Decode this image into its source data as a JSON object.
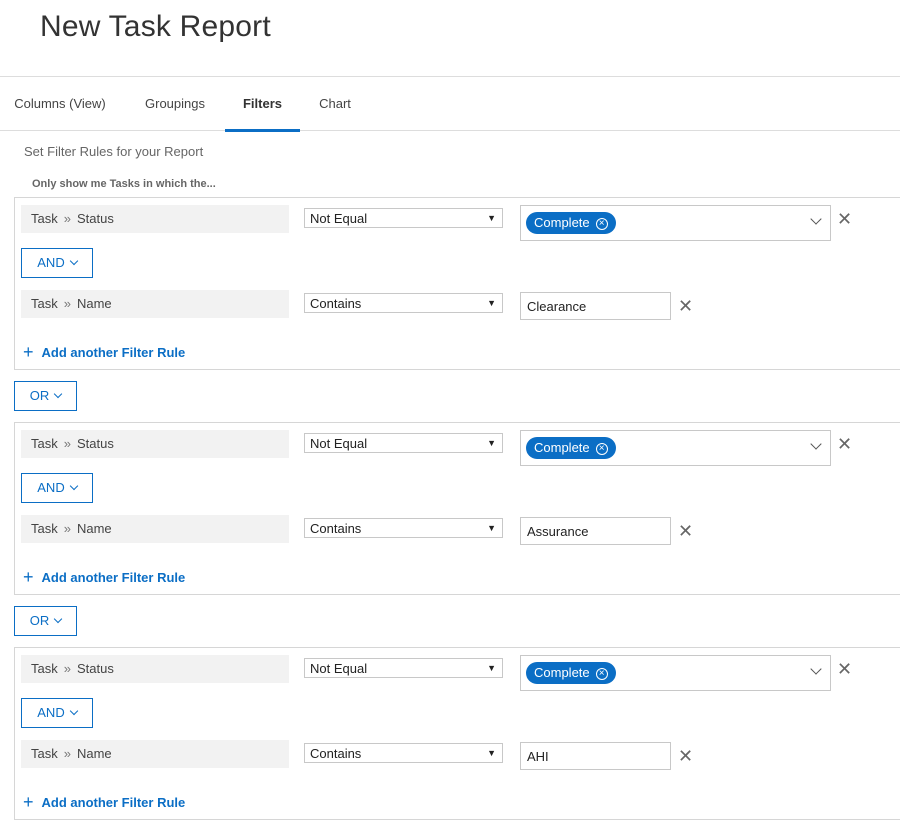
{
  "page": {
    "title": "New Task Report"
  },
  "tabs": [
    {
      "label": "Columns (View)"
    },
    {
      "label": "Groupings"
    },
    {
      "label": "Filters"
    },
    {
      "label": "Chart"
    }
  ],
  "filters": {
    "subtitle": "Set Filter Rules for your Report",
    "hint": "Only show me Tasks in which the...",
    "connector_label": "OR",
    "groups": [
      {
        "rule1": {
          "object": "Task",
          "field": "Status",
          "operator": "Not Equal",
          "value": "Complete"
        },
        "and_label": "AND",
        "rule2": {
          "object": "Task",
          "field": "Name",
          "operator": "Contains",
          "value": "Clearance"
        },
        "add_label": "Add another Filter Rule"
      },
      {
        "rule1": {
          "object": "Task",
          "field": "Status",
          "operator": "Not Equal",
          "value": "Complete"
        },
        "and_label": "AND",
        "rule2": {
          "object": "Task",
          "field": "Name",
          "operator": "Contains",
          "value": "Assurance"
        },
        "add_label": "Add another Filter Rule"
      },
      {
        "rule1": {
          "object": "Task",
          "field": "Status",
          "operator": "Not Equal",
          "value": "Complete"
        },
        "and_label": "AND",
        "rule2": {
          "object": "Task",
          "field": "Name",
          "operator": "Contains",
          "value": "AHI"
        },
        "add_label": "Add another Filter Rule"
      }
    ]
  },
  "colors": {
    "accent": "#0b6ec5",
    "field_bg": "#f2f2f2",
    "border": "#d6d6d6"
  }
}
